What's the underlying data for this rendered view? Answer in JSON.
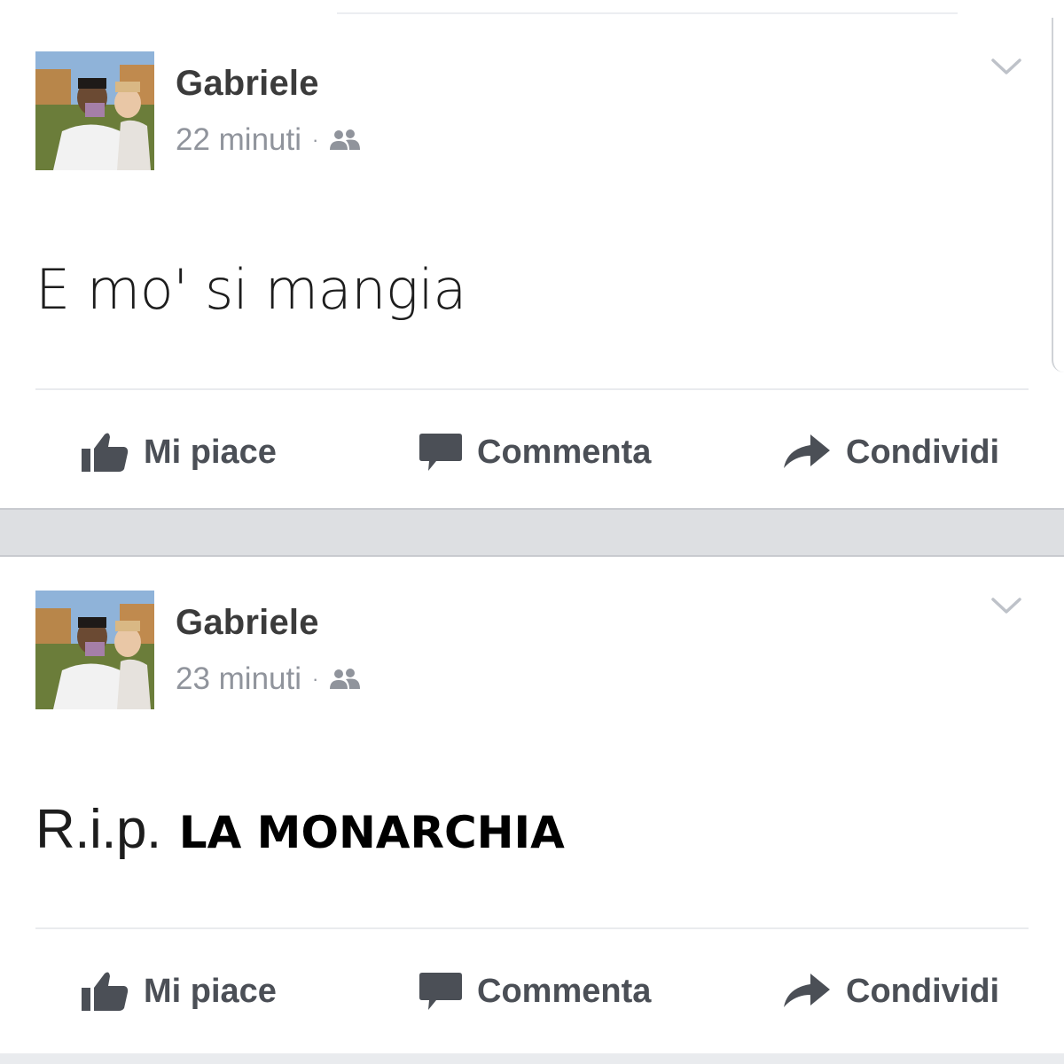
{
  "posts": [
    {
      "author": "Gabriele",
      "timestamp": "22 minuti",
      "separator": "·",
      "audience_icon": "friends-icon",
      "menu_icon": "chevron-down-icon",
      "text": "E mo' si mangia",
      "actions": {
        "like": "Mi piace",
        "comment": "Commenta",
        "share": "Condividi"
      }
    },
    {
      "author": "Gabriele",
      "timestamp": "23 minuti",
      "separator": "·",
      "audience_icon": "friends-icon",
      "menu_icon": "chevron-down-icon",
      "text": "R.i.p.",
      "overlay_text": "LA MONARCHIA",
      "actions": {
        "like": "Mi piace",
        "comment": "Commenta",
        "share": "Condividi"
      }
    }
  ],
  "colors": {
    "action_text": "#4b4f56",
    "meta_text": "#90949c",
    "feed_gap": "#dddfe2"
  }
}
